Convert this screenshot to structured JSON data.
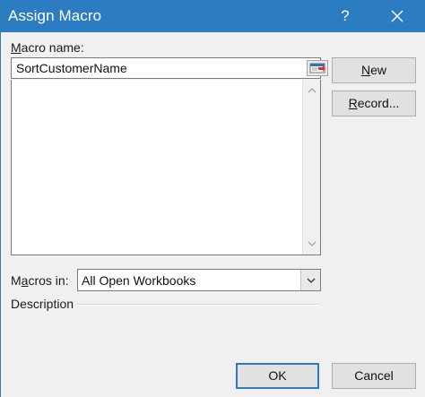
{
  "window": {
    "title": "Assign Macro",
    "help_glyph": "?",
    "close_icon": "close-icon"
  },
  "form": {
    "macro_name_label": "Macro name:",
    "macro_name_value": "SortCustomerName",
    "macros_in_label": "Macros in:",
    "macros_in_value": "All Open Workbooks",
    "description_label": "Description"
  },
  "buttons": {
    "new_label": "New",
    "record_label": "Record...",
    "ok_label": "OK",
    "cancel_label": "Cancel"
  },
  "colors": {
    "titlebar": "#2b7cc0",
    "dialog_bg": "#f0f0f0",
    "button_bg": "#e1e1e1"
  }
}
